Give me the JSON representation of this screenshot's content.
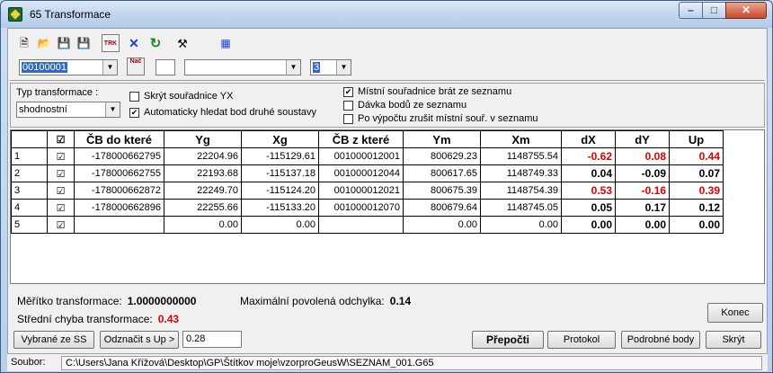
{
  "window": {
    "title": "65  Transformace"
  },
  "toolbar": {
    "icons": [
      "new-document-icon",
      "open-folder-icon",
      "save-disk-icon",
      "save-all-icon",
      "trk-icon",
      "delete-x-icon",
      "refresh-icon",
      "tools-icon",
      "export-icon"
    ],
    "trk_label": "TRK",
    "nac_label": "Nač",
    "point_combo_value": "00100001",
    "mid_combo_value": "",
    "num_combo_value": "3"
  },
  "options": {
    "typ_label": "Typ transformace :",
    "typ_value": "shodnostní",
    "skryt_label": "Skrýt souřadnice YX",
    "skryt_checked": false,
    "auto_label": "Automaticky hledat bod druhé soustavy",
    "auto_checked": true,
    "mistni_label": "Místní souřadnice brát ze seznamu",
    "mistni_checked": true,
    "davka_label": "Dávka bodů ze seznamu",
    "davka_checked": false,
    "zrusit_label": "Po výpočtu zrušit místní souř. v seznamu",
    "zrusit_checked": false
  },
  "grid": {
    "columns": [
      "",
      "☑",
      "ČB do které",
      "Yg",
      "Xg",
      "ČB z které",
      "Ym",
      "Xm",
      "dX",
      "dY",
      "Up"
    ],
    "rows": [
      {
        "num": "1",
        "checked": "☑",
        "cb_do": "-178000662795",
        "yg": "22204.96",
        "xg": "-115129.61",
        "cb_z": "001000012001",
        "ym": "800629.23",
        "xm": "1148755.54",
        "dx": "-0.62",
        "dy": "0.08",
        "up": "0.44",
        "dx_red": true,
        "dy_red": true,
        "up_red": true
      },
      {
        "num": "2",
        "checked": "☑",
        "cb_do": "-178000662755",
        "yg": "22193.68",
        "xg": "-115137.18",
        "cb_z": "001000012044",
        "ym": "800617.65",
        "xm": "1148749.33",
        "dx": "0.04",
        "dy": "-0.09",
        "up": "0.07",
        "dx_red": false,
        "dy_red": false,
        "up_red": false
      },
      {
        "num": "3",
        "checked": "☑",
        "cb_do": "-178000662872",
        "yg": "22249.70",
        "xg": "-115124.20",
        "cb_z": "001000012021",
        "ym": "800675.39",
        "xm": "1148754.39",
        "dx": "0.53",
        "dy": "-0.16",
        "up": "0.39",
        "dx_red": true,
        "dy_red": true,
        "up_red": true
      },
      {
        "num": "4",
        "checked": "☑",
        "cb_do": "-178000662896",
        "yg": "22255.66",
        "xg": "-115133.20",
        "cb_z": "001000012070",
        "ym": "800679.64",
        "xm": "1148745.05",
        "dx": "0.05",
        "dy": "0.17",
        "up": "0.12",
        "dx_red": false,
        "dy_red": false,
        "up_red": false
      },
      {
        "num": "5",
        "checked": "☑",
        "cb_do": "",
        "yg": "0.00",
        "xg": "0.00",
        "cb_z": "",
        "ym": "0.00",
        "xm": "0.00",
        "dx": "0.00",
        "dy": "0.00",
        "up": "0.00",
        "dx_red": false,
        "dy_red": false,
        "up_red": false
      }
    ]
  },
  "summary": {
    "meritko_label": "Měřítko transformace:",
    "meritko_value": "1.0000000000",
    "odchylka_label": "Maximální povolená odchylka:",
    "odchylka_value": "0.14",
    "chyba_label": "Střední chyba transformace:",
    "chyba_value": "0.43"
  },
  "buttons": {
    "vybrane": "Vybrané ze SS",
    "odznacit": "Odznačit s Up >",
    "up_threshold": "0.28",
    "prepocti": "Přepočti",
    "protokol": "Protokol",
    "podrobne": "Podrobné body",
    "skryt": "Skrýt",
    "konec": "Konec"
  },
  "statusbar": {
    "label": "Soubor:",
    "path": "C:\\Users\\Jana Křížová\\Desktop\\GP\\Štítkov moje\\vzorproGeusW\\SEZNAM_001.G65"
  },
  "colors": {
    "accent_red": "#e00000",
    "selection_blue": "#3169c6",
    "title_close": "#c84a30"
  }
}
